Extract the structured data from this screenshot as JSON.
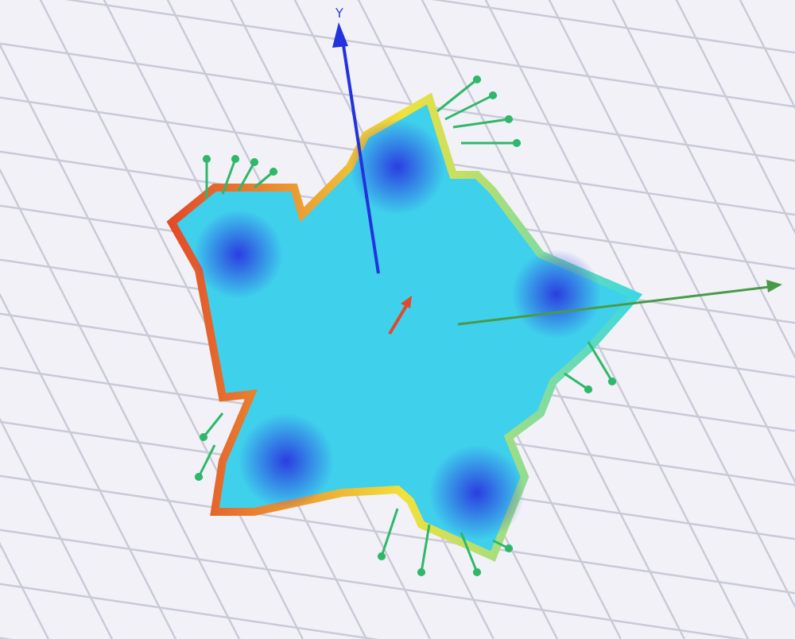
{
  "axis_label": "Y"
}
